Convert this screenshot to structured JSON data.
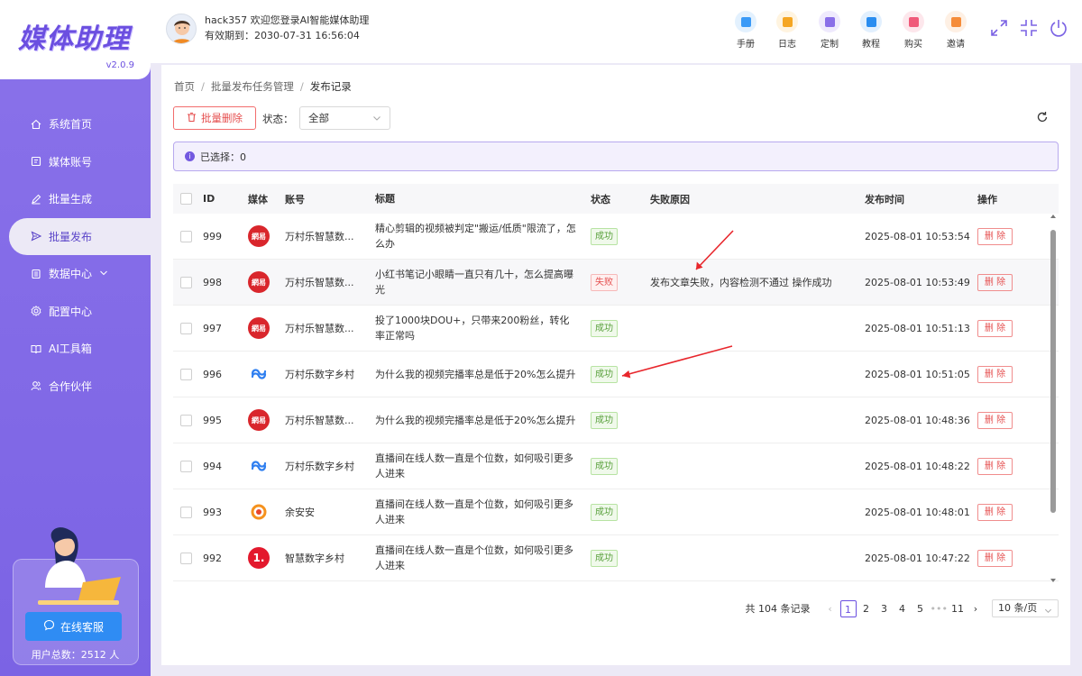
{
  "app": {
    "logo": "媒体助理",
    "version": "v2.0.9"
  },
  "header": {
    "welcome": "hack357 欢迎您登录AI智能媒体助理",
    "expiry": "有效期到：2030-07-31 16:56:04",
    "tools": [
      {
        "label": "手册",
        "color": "#3a9af7",
        "bg": "#e3f1fe"
      },
      {
        "label": "日志",
        "color": "#f5a623",
        "bg": "#fff4e0"
      },
      {
        "label": "定制",
        "color": "#8a6fe8",
        "bg": "#efeafd"
      },
      {
        "label": "教程",
        "color": "#2a8df0",
        "bg": "#e2f0fe"
      },
      {
        "label": "购买",
        "color": "#f05a7a",
        "bg": "#fde7ec"
      },
      {
        "label": "邀请",
        "color": "#f58c3a",
        "bg": "#fef0e4"
      }
    ]
  },
  "sidebar": {
    "items": [
      {
        "label": "系统首页",
        "icon": "home-icon"
      },
      {
        "label": "媒体账号",
        "icon": "account-icon"
      },
      {
        "label": "批量生成",
        "icon": "edit-icon"
      },
      {
        "label": "批量发布",
        "icon": "send-icon"
      },
      {
        "label": "数据中心",
        "icon": "data-icon"
      },
      {
        "label": "配置中心",
        "icon": "settings-icon"
      },
      {
        "label": "AI工具箱",
        "icon": "toolbox-icon"
      },
      {
        "label": "合作伙伴",
        "icon": "partner-icon"
      }
    ],
    "service_button": "在线客服",
    "user_total": "用户总数：2512 人"
  },
  "breadcrumb": [
    "首页",
    "批量发布任务管理",
    "发布记录"
  ],
  "toolbar": {
    "batch_delete": "批量删除",
    "status_label": "状态：",
    "status_value": "全部"
  },
  "selection": "已选择：0",
  "table": {
    "headers": [
      "ID",
      "媒体",
      "账号",
      "标题",
      "状态",
      "失败原因",
      "发布时间",
      "操作"
    ],
    "rows": [
      {
        "id": "999",
        "media": "wangyi",
        "account": "万村乐智慧数...",
        "title": "精心剪辑的视频被判定\"搬运/低质\"限流了，怎么办",
        "status": "成功",
        "reason": "",
        "time": "2025-08-01 10:53:54",
        "op": "删 除"
      },
      {
        "id": "998",
        "media": "wangyi",
        "account": "万村乐智慧数...",
        "title": "小红书笔记小眼睛一直只有几十，怎么提高曝光",
        "status": "失败",
        "reason": "发布文章失败，内容检测不通过 操作成功",
        "time": "2025-08-01 10:53:49",
        "op": "删 除"
      },
      {
        "id": "997",
        "media": "wangyi",
        "account": "万村乐智慧数...",
        "title": "投了1000块DOU+，只带来200粉丝，转化率正常吗",
        "status": "成功",
        "reason": "",
        "time": "2025-08-01 10:51:13",
        "op": "删 除"
      },
      {
        "id": "996",
        "media": "bjh",
        "account": "万村乐数字乡村",
        "title": "为什么我的视频完播率总是低于20%怎么提升",
        "status": "成功",
        "reason": "",
        "time": "2025-08-01 10:51:05",
        "op": "删 除"
      },
      {
        "id": "995",
        "media": "wangyi",
        "account": "万村乐智慧数...",
        "title": "为什么我的视频完播率总是低于20%怎么提升",
        "status": "成功",
        "reason": "",
        "time": "2025-08-01 10:48:36",
        "op": "删 除"
      },
      {
        "id": "994",
        "media": "bjh",
        "account": "万村乐数字乡村",
        "title": "直播间在线人数一直是个位数，如何吸引更多人进来",
        "status": "成功",
        "reason": "",
        "time": "2025-08-01 10:48:22",
        "op": "删 除"
      },
      {
        "id": "993",
        "media": "sohu",
        "account": "余安安",
        "title": "直播间在线人数一直是个位数，如何吸引更多人进来",
        "status": "成功",
        "reason": "",
        "time": "2025-08-01 10:48:01",
        "op": "删 除"
      },
      {
        "id": "992",
        "media": "yidian",
        "account": "智慧数字乡村",
        "title": "直播间在线人数一直是个位数，如何吸引更多人进来",
        "status": "成功",
        "reason": "",
        "time": "2025-08-01 10:47:22",
        "op": "删 除"
      }
    ]
  },
  "media_icons": {
    "wangyi": {
      "text": "網易",
      "bg": "#d9262c",
      "fg": "#ffffff"
    },
    "yidian": {
      "text": "1.",
      "bg": "#e3192d",
      "fg": "#ffffff"
    }
  },
  "pagination": {
    "total": "共 104 条记录",
    "pages": [
      "1",
      "2",
      "3",
      "4",
      "5",
      "•••",
      "11"
    ],
    "current": "1",
    "page_size": "10 条/页"
  },
  "colors": {
    "accent": "#6b4fe0",
    "danger": "#e55050",
    "success": "#58a03b"
  }
}
